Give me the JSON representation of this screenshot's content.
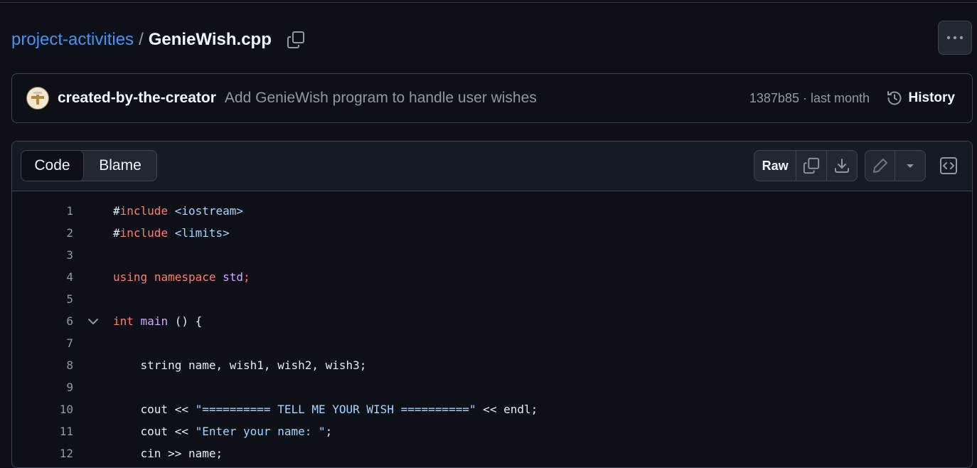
{
  "breadcrumb": {
    "repo": "project-activities",
    "separator": "/",
    "file": "GenieWish.cpp"
  },
  "commit": {
    "author": "created-by-the-creator",
    "message": "Add GenieWish program to handle user wishes",
    "meta": "1387b85 · last month",
    "history_label": "History"
  },
  "toolbar": {
    "code_tab": "Code",
    "blame_tab": "Blame",
    "raw_label": "Raw"
  },
  "code_lines": [
    {
      "n": "1",
      "fold": false,
      "tokens": [
        {
          "t": "#"
        },
        {
          "t": "include",
          "c": "kw"
        },
        {
          "t": " "
        },
        {
          "t": "<iostream>",
          "c": "str"
        }
      ]
    },
    {
      "n": "2",
      "fold": false,
      "tokens": [
        {
          "t": "#"
        },
        {
          "t": "include",
          "c": "kw"
        },
        {
          "t": " "
        },
        {
          "t": "<limits>",
          "c": "str"
        }
      ]
    },
    {
      "n": "3",
      "fold": false,
      "tokens": []
    },
    {
      "n": "4",
      "fold": false,
      "tokens": [
        {
          "t": "using",
          "c": "kw"
        },
        {
          "t": " "
        },
        {
          "t": "namespace",
          "c": "kw"
        },
        {
          "t": " "
        },
        {
          "t": "std",
          "c": "fn"
        },
        {
          "t": ";",
          "c": "kw"
        }
      ]
    },
    {
      "n": "5",
      "fold": false,
      "tokens": []
    },
    {
      "n": "6",
      "fold": true,
      "tokens": [
        {
          "t": "int",
          "c": "kw"
        },
        {
          "t": " "
        },
        {
          "t": "main",
          "c": "fn"
        },
        {
          "t": " () {"
        }
      ]
    },
    {
      "n": "7",
      "fold": false,
      "tokens": []
    },
    {
      "n": "8",
      "fold": false,
      "tokens": [
        {
          "t": "    string name, wish1, wish2, wish3;"
        }
      ]
    },
    {
      "n": "9",
      "fold": false,
      "tokens": []
    },
    {
      "n": "10",
      "fold": false,
      "tokens": [
        {
          "t": "    cout << "
        },
        {
          "t": "\"========== TELL ME YOUR WISH ==========\"",
          "c": "str"
        },
        {
          "t": " << endl;"
        }
      ]
    },
    {
      "n": "11",
      "fold": false,
      "tokens": [
        {
          "t": "    cout << "
        },
        {
          "t": "\"Enter your name: \"",
          "c": "str"
        },
        {
          "t": ";"
        }
      ]
    },
    {
      "n": "12",
      "fold": false,
      "tokens": [
        {
          "t": "    cin >> name;"
        }
      ]
    }
  ]
}
